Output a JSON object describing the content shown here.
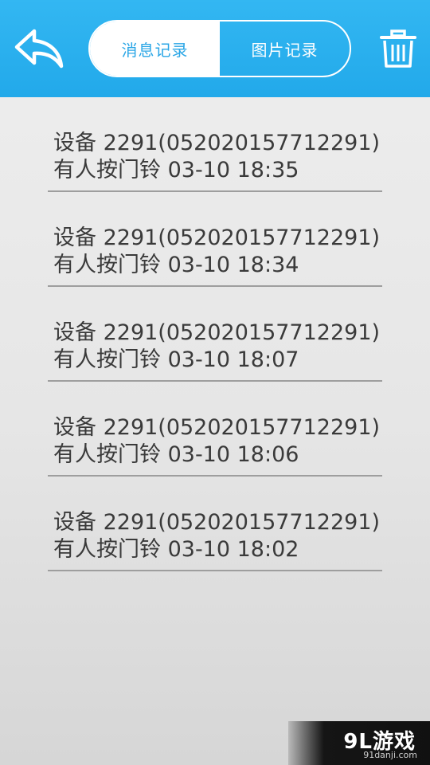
{
  "header": {
    "tabs": [
      {
        "label": "消息记录",
        "active": true
      },
      {
        "label": "图片记录",
        "active": false
      }
    ],
    "back_icon": "back-arrow-icon",
    "delete_icon": "trash-icon"
  },
  "records": [
    {
      "device": "设备 2291(052020157712291)",
      "event": "有人按门铃 03-10 18:35"
    },
    {
      "device": "设备 2291(052020157712291)",
      "event": "有人按门铃 03-10 18:34"
    },
    {
      "device": "设备 2291(052020157712291)",
      "event": "有人按门铃 03-10 18:07"
    },
    {
      "device": "设备 2291(052020157712291)",
      "event": "有人按门铃 03-10 18:06"
    },
    {
      "device": "设备 2291(052020157712291)",
      "event": "有人按门铃 03-10 18:02"
    }
  ],
  "watermark": {
    "logo": "9L游戏",
    "url": "91danji.com"
  },
  "colors": {
    "header": "#22a9ea",
    "accent": "#2aa6e6",
    "text": "#3a3a3a",
    "divider": "#9e9e9e"
  }
}
